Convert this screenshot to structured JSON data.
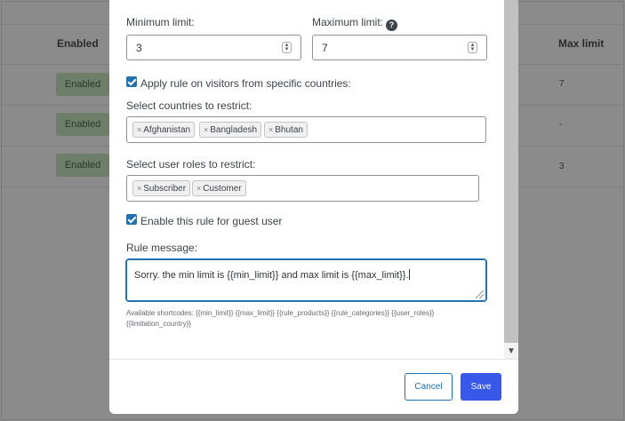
{
  "background": {
    "columns": {
      "enabled": "Enabled",
      "max_limit": "Max limit"
    },
    "rows": [
      {
        "status": "Enabled",
        "max": "7"
      },
      {
        "status": "Enabled",
        "max": "-"
      },
      {
        "status": "Enabled",
        "max": "3"
      }
    ]
  },
  "form": {
    "min_limit": {
      "label": "Minimum limit:",
      "value": "3"
    },
    "max_limit": {
      "label": "Maximum limit:",
      "value": "7",
      "help_glyph": "?"
    },
    "apply_countries": {
      "label": "Apply rule on visitors from specific countries:",
      "checked": true
    },
    "countries": {
      "label": "Select countries to restrict:",
      "remove_glyph": "×",
      "tags": [
        "Afghanistan",
        "Bangladesh",
        "Bhutan"
      ]
    },
    "roles": {
      "label": "Select user roles to restrict:",
      "tags": [
        "Subscriber",
        "Customer"
      ]
    },
    "guest_rule": {
      "label": "Enable this rule for guest user",
      "checked": true
    },
    "message": {
      "label": "Rule message:",
      "value": "Sorry. the min limit is  {{min_limit}} and max limit is {{max_limit}}."
    },
    "shortcodes_hint": "Available shortcodes: {{min_limit}} {{max_limit}} {{rule_products}} {{rule_categories}} {{user_roles}} {{limitation_country}}"
  },
  "footer": {
    "cancel_label": "Cancel",
    "save_label": "Save"
  },
  "icons": {
    "spin": "spinner-arrows-icon",
    "scroll_down": "chevron-down-icon",
    "help": "question-circle-icon"
  },
  "colors": {
    "accent": "#2271b1",
    "primary_button": "#3858e9",
    "overlay": "#8b8b8b"
  }
}
